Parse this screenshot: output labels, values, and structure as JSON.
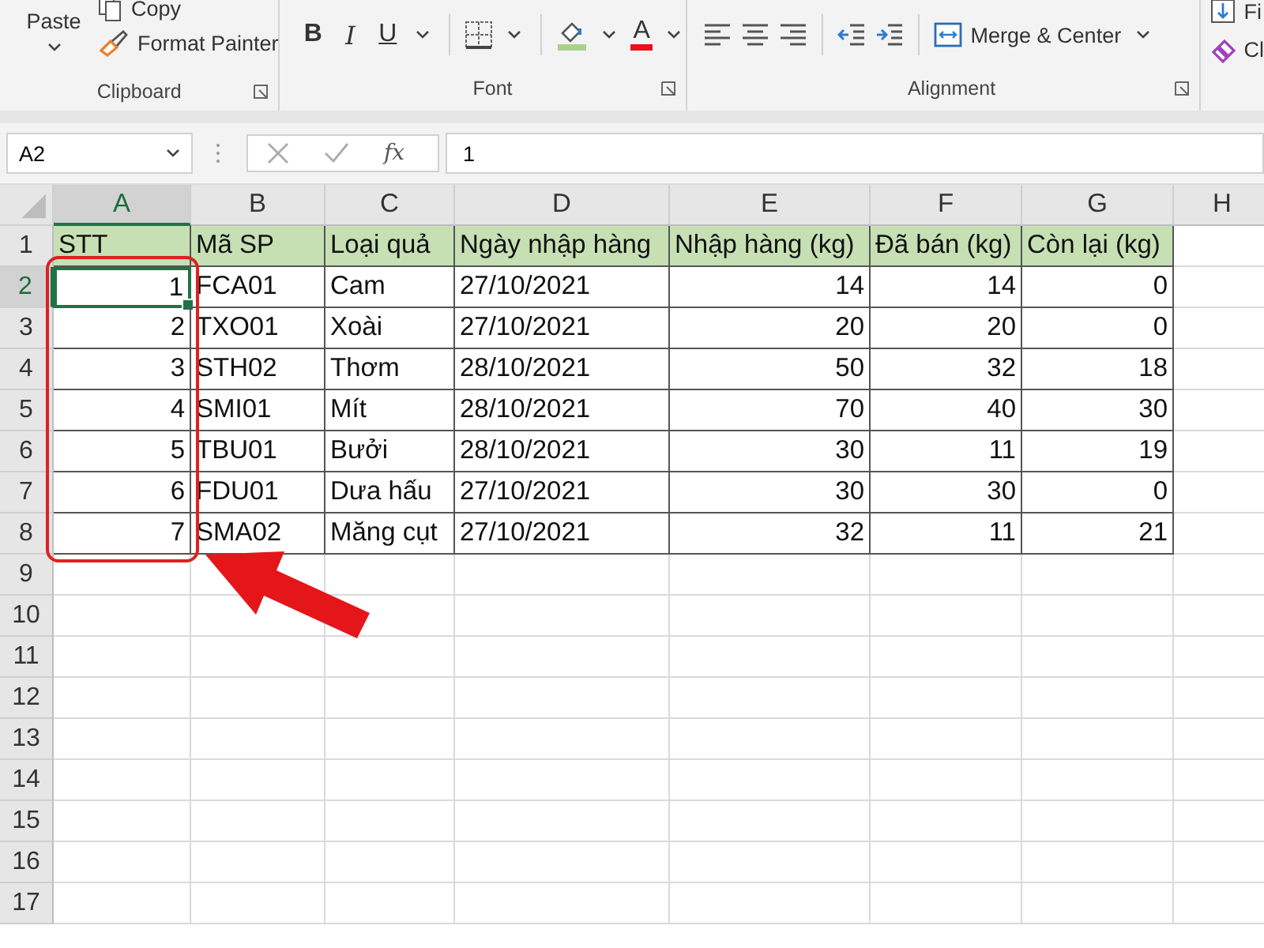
{
  "ribbon": {
    "clipboard": {
      "paste": "Paste",
      "copy": "Copy",
      "format_painter": "Format Painter",
      "label": "Clipboard"
    },
    "font": {
      "bold": "B",
      "italic": "I",
      "underline": "U",
      "font_color": "A",
      "label": "Font"
    },
    "alignment": {
      "merge": "Merge & Center",
      "label": "Alignment"
    },
    "editing": {
      "items": [
        "Fi",
        "Cl"
      ]
    }
  },
  "name_box": "A2",
  "formula_bar": {
    "fx": "fx",
    "value": "1"
  },
  "sheet": {
    "columns": [
      {
        "label": "A",
        "selected": true,
        "kind": "number"
      },
      {
        "label": "B",
        "selected": false,
        "kind": "text"
      },
      {
        "label": "C",
        "selected": false,
        "kind": "text"
      },
      {
        "label": "D",
        "selected": false,
        "kind": "text"
      },
      {
        "label": "E",
        "selected": false,
        "kind": "number"
      },
      {
        "label": "F",
        "selected": false,
        "kind": "number"
      },
      {
        "label": "G",
        "selected": false,
        "kind": "number"
      },
      {
        "label": "H",
        "selected": false
      }
    ],
    "rows": [
      {
        "number": "1",
        "selected": false,
        "kind": "header",
        "cells": [
          "STT",
          "Mã SP",
          "Loại quả",
          "Ngày nhập hàng",
          "Nhập hàng (kg)",
          "Đã bán (kg)",
          "Còn lại (kg)"
        ]
      },
      {
        "number": "2",
        "selected": true,
        "kind": "data",
        "cells": [
          "1",
          "FCA01",
          "Cam",
          "27/10/2021",
          "14",
          "14",
          "0"
        ]
      },
      {
        "number": "3",
        "selected": false,
        "kind": "data",
        "cells": [
          "2",
          "TXO01",
          "Xoài",
          "27/10/2021",
          "20",
          "20",
          "0"
        ]
      },
      {
        "number": "4",
        "selected": false,
        "kind": "data",
        "cells": [
          "3",
          "STH02",
          "Thơm",
          "28/10/2021",
          "50",
          "32",
          "18"
        ]
      },
      {
        "number": "5",
        "selected": false,
        "kind": "data",
        "cells": [
          "4",
          "SMI01",
          "Mít",
          "28/10/2021",
          "70",
          "40",
          "30"
        ]
      },
      {
        "number": "6",
        "selected": false,
        "kind": "data",
        "cells": [
          "5",
          "TBU01",
          "Bưởi",
          "28/10/2021",
          "30",
          "11",
          "19"
        ]
      },
      {
        "number": "7",
        "selected": false,
        "kind": "data",
        "cells": [
          "6",
          "FDU01",
          "Dưa hấu",
          "27/10/2021",
          "30",
          "30",
          "0"
        ]
      },
      {
        "number": "8",
        "selected": false,
        "kind": "data",
        "cells": [
          "7",
          "SMA02",
          "Măng cụt",
          "27/10/2021",
          "32",
          "11",
          "21"
        ]
      },
      {
        "number": "9",
        "selected": false,
        "kind": "empty"
      },
      {
        "number": "10",
        "selected": false,
        "kind": "empty"
      },
      {
        "number": "11",
        "selected": false,
        "kind": "empty"
      },
      {
        "number": "12",
        "selected": false,
        "kind": "empty"
      },
      {
        "number": "13",
        "selected": false,
        "kind": "empty"
      },
      {
        "number": "14",
        "selected": false,
        "kind": "empty"
      },
      {
        "number": "15",
        "selected": false,
        "kind": "empty"
      },
      {
        "number": "16",
        "selected": false,
        "kind": "empty"
      },
      {
        "number": "17",
        "selected": false,
        "kind": "empty"
      }
    ]
  }
}
